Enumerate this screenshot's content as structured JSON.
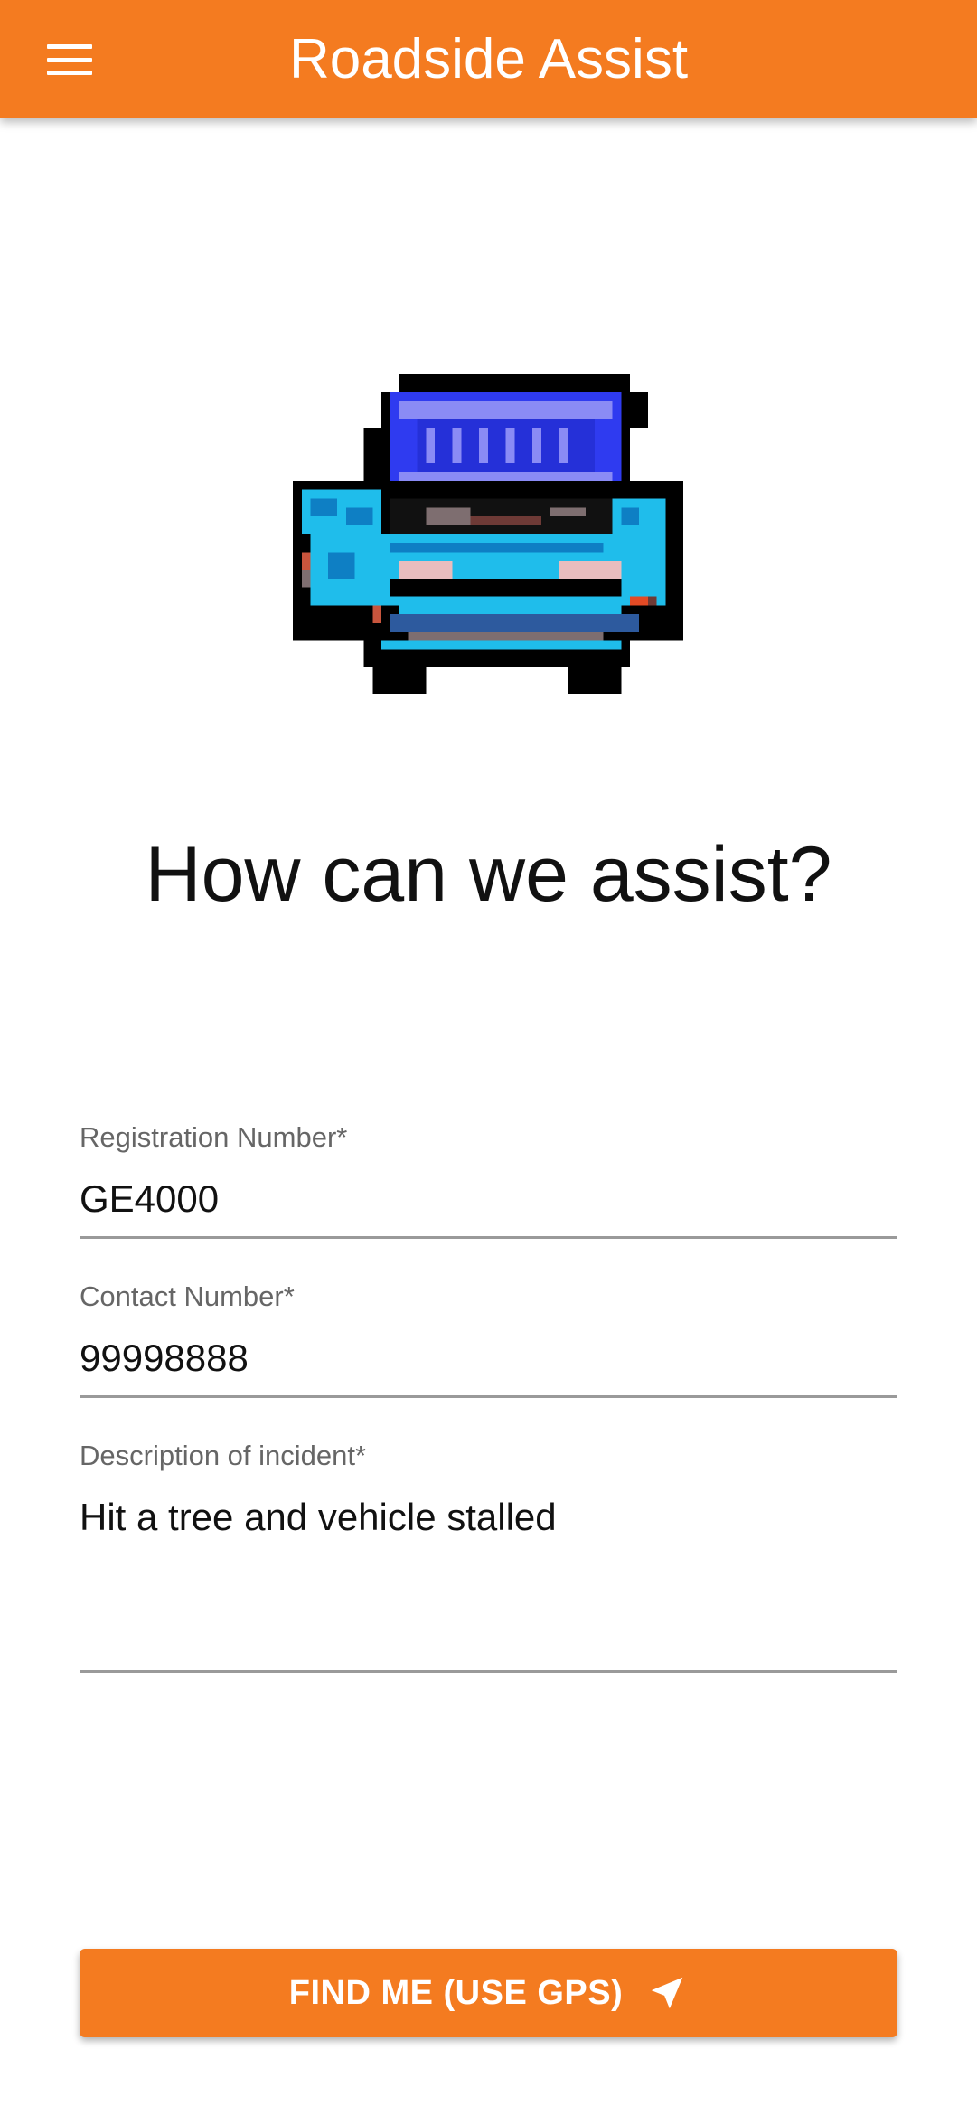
{
  "header": {
    "title": "Roadside Assist",
    "menu_icon": "hamburger-menu-icon"
  },
  "hero": {
    "image": "pixel-art-broken-car-hood-open",
    "heading": "How can we assist?"
  },
  "form": {
    "registration": {
      "label": "Registration Number*",
      "value": "GE4000"
    },
    "contact": {
      "label": "Contact Number*",
      "value": "99998888"
    },
    "description": {
      "label": "Description of incident*",
      "value": "Hit a tree and vehicle stalled"
    }
  },
  "actions": {
    "gps_button_label": "FIND ME (USE GPS)",
    "gps_icon": "navigation-arrow-icon"
  },
  "colors": {
    "accent": "#F47B20",
    "text": "#111111",
    "label": "#666666",
    "underline": "#9a9a9a"
  }
}
